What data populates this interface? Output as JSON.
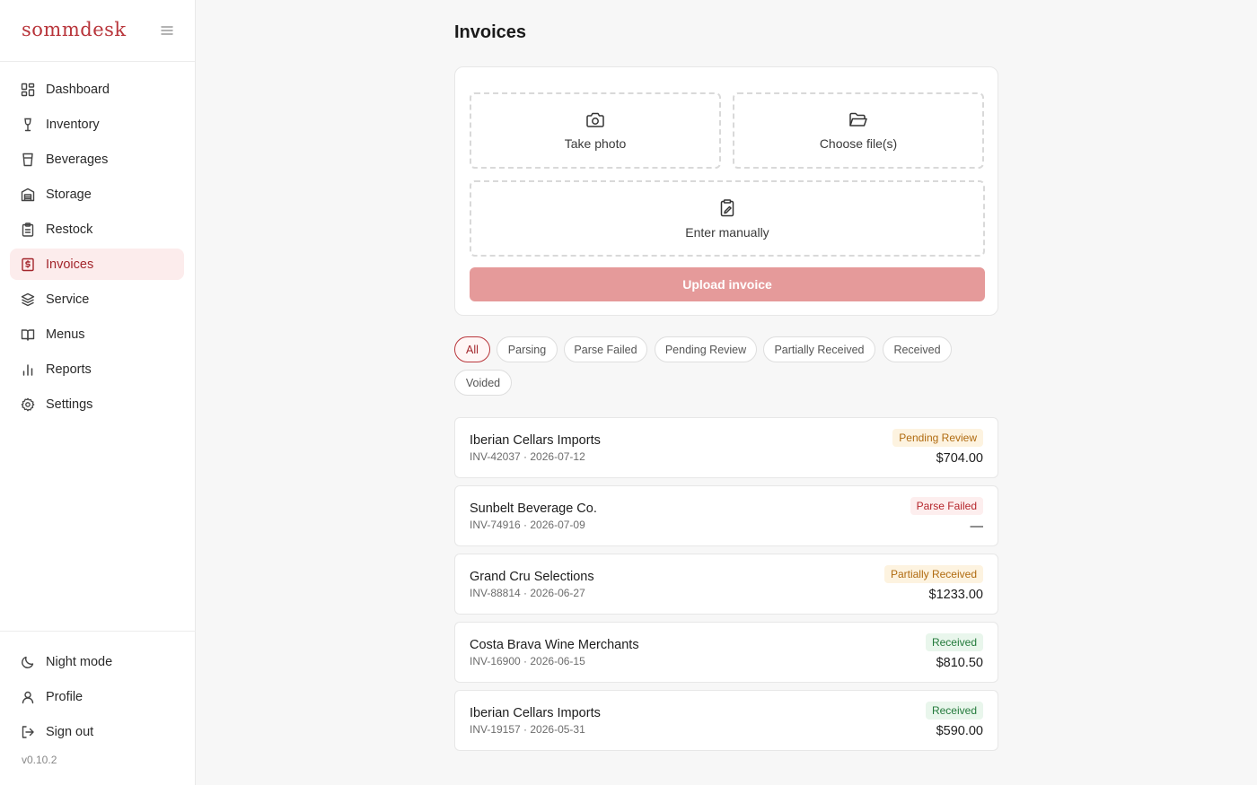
{
  "brand": {
    "name": "sommdesk"
  },
  "sidebar": {
    "items": [
      {
        "label": "Dashboard",
        "icon": "dashboard-icon",
        "active": false
      },
      {
        "label": "Inventory",
        "icon": "wine-glass-icon",
        "active": false
      },
      {
        "label": "Beverages",
        "icon": "cup-icon",
        "active": false
      },
      {
        "label": "Storage",
        "icon": "warehouse-icon",
        "active": false
      },
      {
        "label": "Restock",
        "icon": "clipboard-list-icon",
        "active": false
      },
      {
        "label": "Invoices",
        "icon": "receipt-dollar-icon",
        "active": true
      },
      {
        "label": "Service",
        "icon": "layers-icon",
        "active": false
      },
      {
        "label": "Menus",
        "icon": "book-open-icon",
        "active": false
      },
      {
        "label": "Reports",
        "icon": "bar-chart-icon",
        "active": false
      },
      {
        "label": "Settings",
        "icon": "gear-icon",
        "active": false
      }
    ],
    "bottom": [
      {
        "label": "Night mode",
        "icon": "moon-icon"
      },
      {
        "label": "Profile",
        "icon": "user-icon"
      },
      {
        "label": "Sign out",
        "icon": "sign-out-icon"
      }
    ],
    "version": "v0.10.2"
  },
  "main": {
    "title": "Invoices",
    "upload": {
      "take_photo": "Take photo",
      "choose_files": "Choose file(s)",
      "enter_manually": "Enter manually",
      "upload_button": "Upload invoice"
    },
    "filters": [
      "All",
      "Parsing",
      "Parse Failed",
      "Pending Review",
      "Partially Received",
      "Received",
      "Voided"
    ],
    "active_filter": "All",
    "invoices": [
      {
        "vendor": "Iberian Cellars Imports",
        "meta": "INV-42037 · 2026-07-12",
        "status": "Pending Review",
        "status_kind": "pending",
        "amount": "$704.00"
      },
      {
        "vendor": "Sunbelt Beverage Co.",
        "meta": "INV-74916 · 2026-07-09",
        "status": "Parse Failed",
        "status_kind": "failed",
        "amount": "—"
      },
      {
        "vendor": "Grand Cru Selections",
        "meta": "INV-88814 · 2026-06-27",
        "status": "Partially Received",
        "status_kind": "partial",
        "amount": "$1233.00"
      },
      {
        "vendor": "Costa Brava Wine Merchants",
        "meta": "INV-16900 · 2026-06-15",
        "status": "Received",
        "status_kind": "received",
        "amount": "$810.50"
      },
      {
        "vendor": "Iberian Cellars Imports",
        "meta": "INV-19157 · 2026-05-31",
        "status": "Received",
        "status_kind": "received",
        "amount": "$590.00"
      }
    ]
  },
  "colors": {
    "accent": "#b8343a",
    "active_nav_bg": "#fcecec",
    "upload_button": "#e59a9a",
    "pending": "#b06b10",
    "failed": "#b5262c",
    "received": "#237a3b"
  }
}
